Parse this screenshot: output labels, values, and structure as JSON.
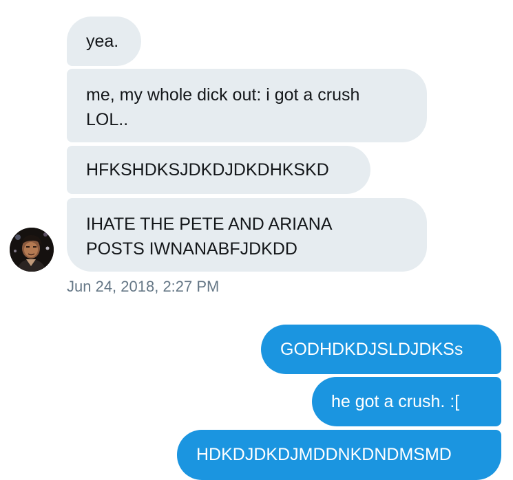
{
  "conversation": {
    "incoming_messages": [
      "yea.",
      "me, my whole dick out: i got a crush\nLOL..",
      "HFKSHDKSJDKDJDKDHKSKD",
      "IHATE THE PETE AND ARIANA\nPOSTS IWNANABFJDKDD"
    ],
    "timestamp": "Jun 24, 2018, 2:27 PM",
    "outgoing_messages": [
      "GODHDKDJSLDJDKSs",
      "he got a crush. :[",
      "HDKDJDKDJMDDNKDNDMSMD"
    ]
  },
  "colors": {
    "incoming_bubble": "#e6ecf0",
    "outgoing_bubble": "#1b95e0",
    "timestamp_text": "#657786"
  },
  "icons": {
    "avatar": "user-avatar-photo"
  }
}
